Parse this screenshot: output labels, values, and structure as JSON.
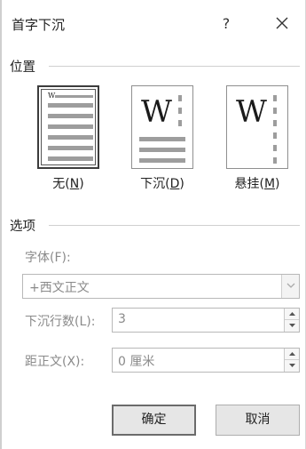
{
  "dialog": {
    "title": "首字下沉",
    "help_glyph": "?",
    "close_glyph": "×"
  },
  "position_section": {
    "label": "位置",
    "options": [
      {
        "label_main": "无(",
        "mnemonic": "N",
        "label_end": ")",
        "selected": true
      },
      {
        "label_main": "下沉(",
        "mnemonic": "D",
        "label_end": ")",
        "selected": false
      },
      {
        "label_main": "悬挂(",
        "mnemonic": "M",
        "label_end": ")",
        "selected": false
      }
    ],
    "glyph": "W"
  },
  "options_section": {
    "label": "选项",
    "font_label": "字体(F):",
    "font_value": "+西文正文",
    "lines_label": "下沉行数(L):",
    "lines_value": "3",
    "distance_label": "距正文(X):",
    "distance_value": "0 厘米"
  },
  "buttons": {
    "ok": "确定",
    "cancel": "取消"
  }
}
